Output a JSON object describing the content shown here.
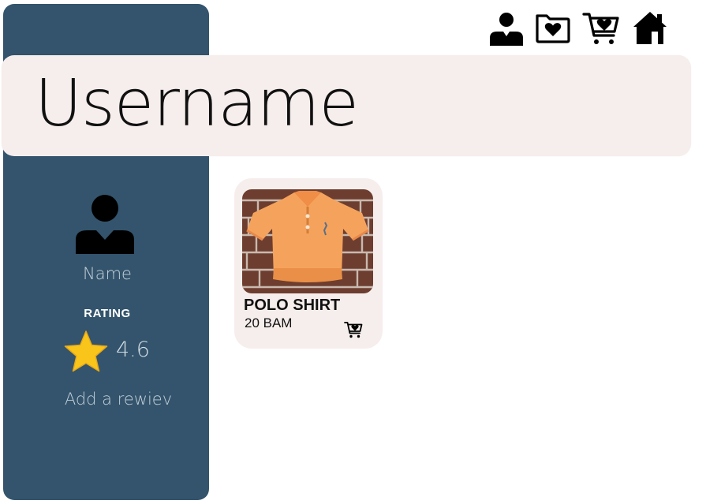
{
  "header": {
    "username": "Username"
  },
  "nav": {
    "icons": [
      "profile-icon",
      "favorites-folder-icon",
      "cart-heart-icon",
      "home-icon"
    ]
  },
  "sidebar": {
    "name": "Name",
    "rating_label": "RATING",
    "rating_value": "4.6",
    "rating_icon": "star-icon",
    "add_review": "Add a rewiev"
  },
  "products": [
    {
      "name": "POLO SHIRT",
      "price": "20 BAM",
      "image": "orange-polo-shirt-photo",
      "cart_icon": "cart-heart-icon"
    }
  ],
  "colors": {
    "sidebar": "#33546c",
    "banner": "#f6eeec",
    "card": "#f6eeec",
    "star": "#f9c51a",
    "shirt": "#f5a35c"
  }
}
